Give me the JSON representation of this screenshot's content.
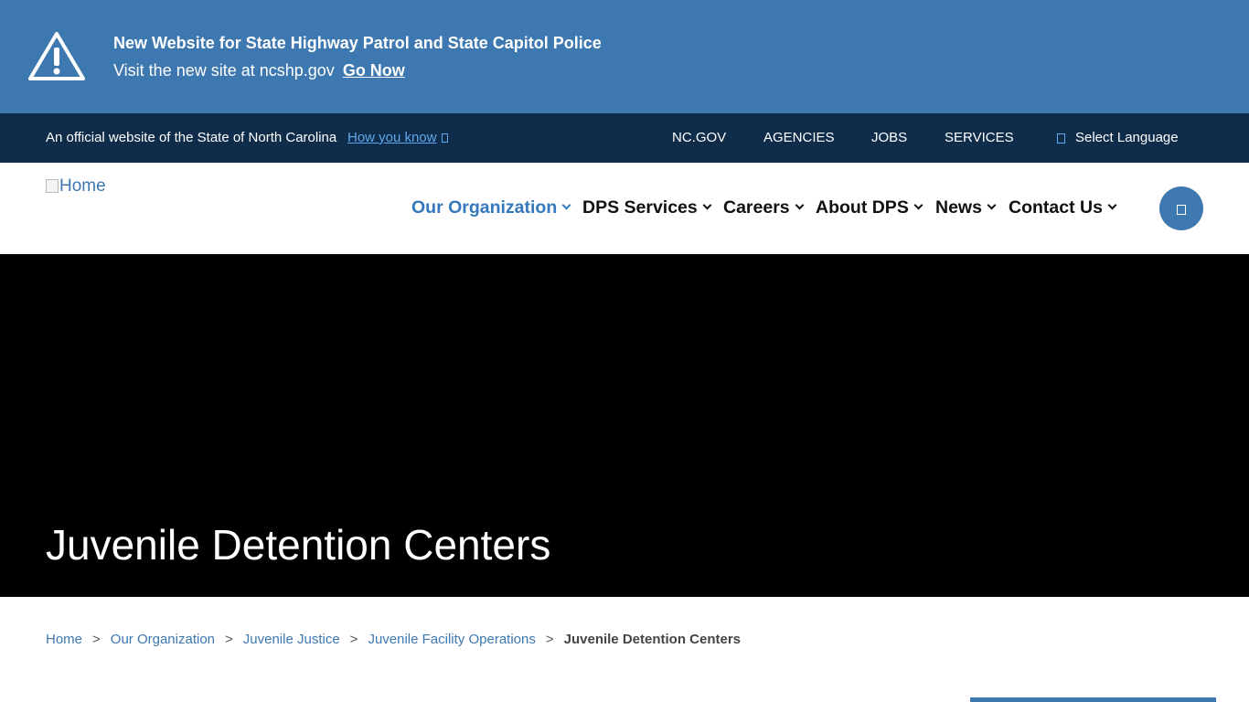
{
  "alert": {
    "title": "New Website for State Highway Patrol and State Capitol Police",
    "text": "Visit the new site at ncshp.gov",
    "link": "Go Now",
    "icon": "warning-icon"
  },
  "official": {
    "text": "An official website of the State of North Carolina",
    "link": "How you know",
    "links": [
      "NC.GOV",
      "AGENCIES",
      "JOBS",
      "SERVICES"
    ],
    "language": "Select Language"
  },
  "header": {
    "logo_alt": "Home",
    "nav": [
      "Our Organization",
      "DPS Services",
      "Careers",
      "About DPS",
      "News",
      "Contact Us"
    ],
    "search_icon": "search-icon"
  },
  "hero": {
    "title": "Juvenile Detention Centers"
  },
  "breadcrumb": {
    "items": [
      "Home",
      "Our Organization",
      "Juvenile Justice",
      "Juvenile Facility Operations"
    ],
    "current": "Juvenile Detention Centers",
    "separator": ">"
  },
  "colors": {
    "alert_bg": "#3e78b0",
    "official_bg": "#0f2d4a",
    "accent": "#3479bd",
    "hero_bg": "#000000"
  }
}
